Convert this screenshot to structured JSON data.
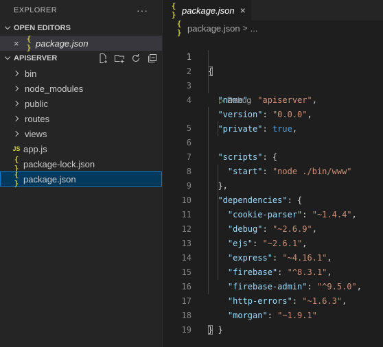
{
  "explorer": {
    "title": "EXPLORER",
    "more": "···",
    "open_editors": {
      "title": "OPEN EDITORS",
      "items": [
        {
          "close": "×",
          "icon": "{ }",
          "name": "package.json"
        }
      ]
    },
    "project": {
      "title": "APISERVER",
      "items": [
        {
          "type": "folder",
          "name": "bin"
        },
        {
          "type": "folder",
          "name": "node_modules"
        },
        {
          "type": "folder",
          "name": "public"
        },
        {
          "type": "folder",
          "name": "routes"
        },
        {
          "type": "folder",
          "name": "views"
        },
        {
          "type": "file",
          "icon": "JS",
          "name": "app.js"
        },
        {
          "type": "file",
          "icon": "{ }",
          "name": "package-lock.json"
        },
        {
          "type": "file",
          "icon": "{ }",
          "name": "package.json",
          "selected": true
        }
      ]
    }
  },
  "tab": {
    "icon": "{ }",
    "name": "package.json",
    "close": "×"
  },
  "breadcrumb": {
    "icon": "{ }",
    "file": "package.json",
    "sep": ">",
    "more": "..."
  },
  "codelens": {
    "icon": "▷",
    "label": "Debug"
  },
  "code": {
    "line_numbers": [
      "1",
      "2",
      "3",
      "4",
      "5",
      "6",
      "7",
      "8",
      "9",
      "10",
      "11",
      "12",
      "13",
      "14",
      "15",
      "16",
      "17",
      "18",
      "19"
    ],
    "l1": "{",
    "name_key": "\"name\"",
    "name_val": "\"apiserver\"",
    "version_key": "\"version\"",
    "version_val": "\"0.0.0\"",
    "private_key": "\"private\"",
    "private_val": "true",
    "scripts_key": "\"scripts\"",
    "start_key": "\"start\"",
    "start_val": "\"node ./bin/www\"",
    "deps_key": "\"dependencies\"",
    "deps": [
      {
        "k": "\"cookie-parser\"",
        "v": "\"~1.4.4\""
      },
      {
        "k": "\"debug\"",
        "v": "\"~2.6.9\""
      },
      {
        "k": "\"ejs\"",
        "v": "\"~2.6.1\""
      },
      {
        "k": "\"express\"",
        "v": "\"~4.16.1\""
      },
      {
        "k": "\"firebase\"",
        "v": "\"^8.3.1\""
      },
      {
        "k": "\"firebase-admin\"",
        "v": "\"^9.5.0\""
      },
      {
        "k": "\"http-errors\"",
        "v": "\"~1.6.3\""
      },
      {
        "k": "\"morgan\"",
        "v": "\"~1.9.1\""
      }
    ]
  }
}
